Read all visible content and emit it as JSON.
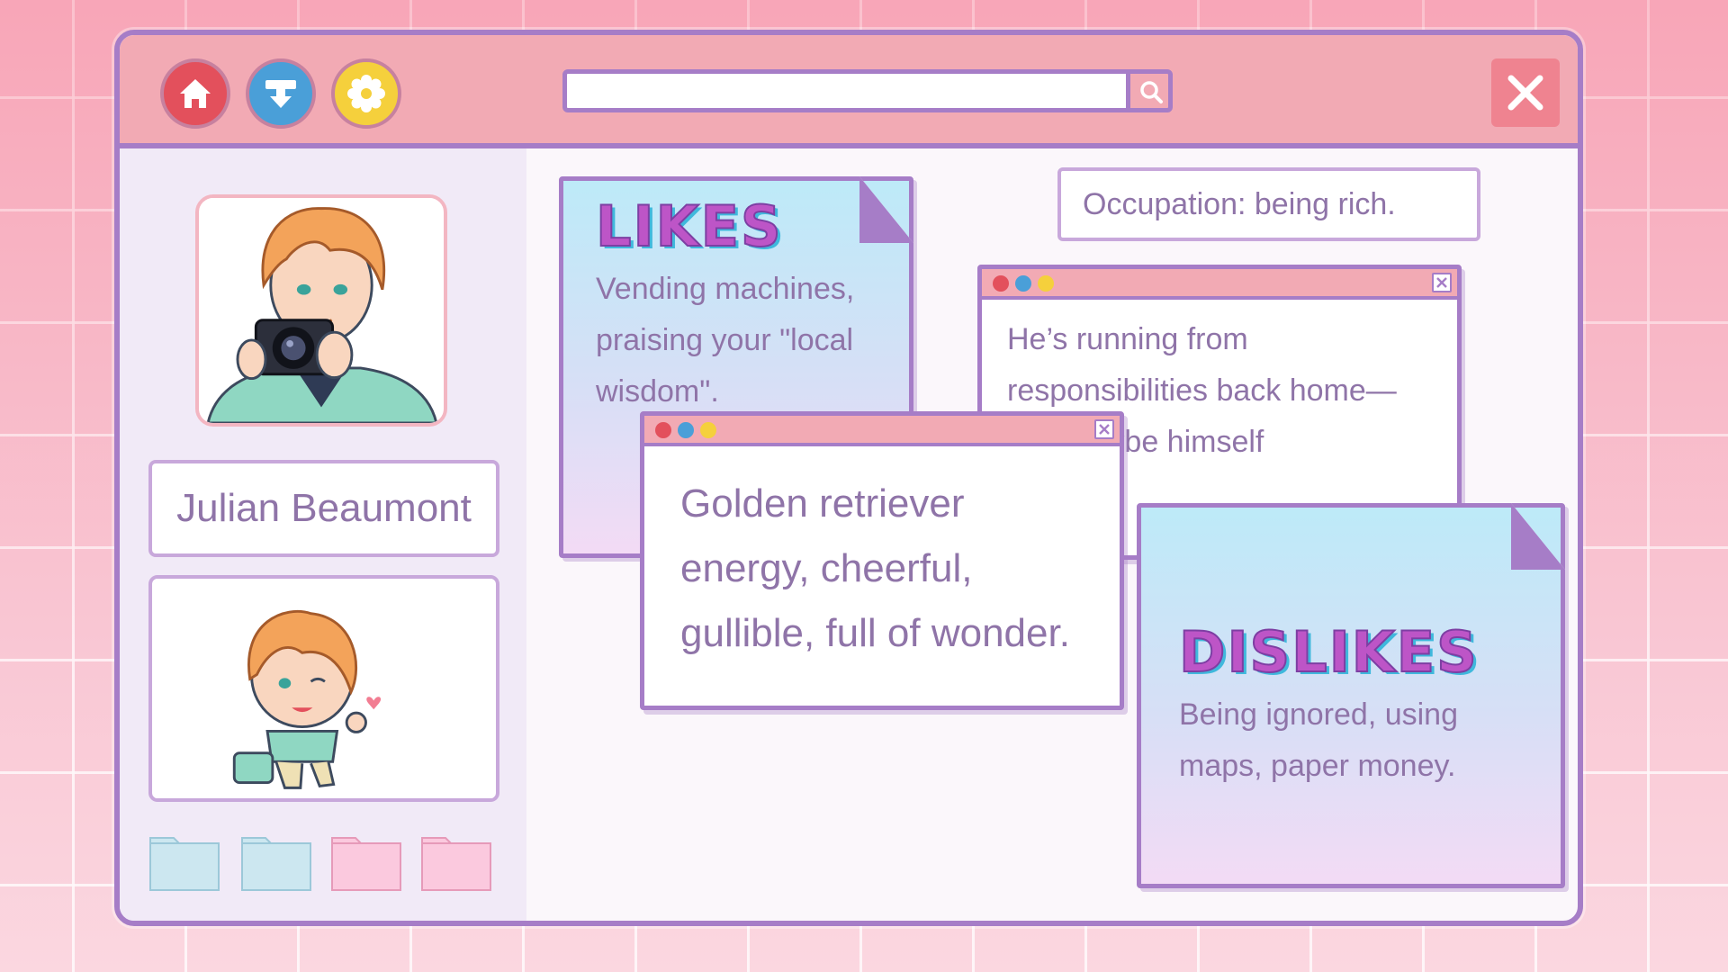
{
  "toolbar": {
    "home_icon": "home-icon",
    "download_icon": "download-icon",
    "settings_icon": "gear-icon",
    "search": {
      "value": "",
      "icon": "search-icon"
    },
    "close_icon": "close-icon"
  },
  "profile": {
    "name": "Julian Beaumont",
    "folders": [
      {
        "color": "#cce7f0"
      },
      {
        "color": "#cce7f0"
      },
      {
        "color": "#fbc9de"
      },
      {
        "color": "#fbc9de"
      }
    ]
  },
  "likes": {
    "title": "LIKES",
    "text": "Vending machines, praising your \"local wisdom\"."
  },
  "dislikes": {
    "title": "DISLIKES",
    "text": "Being ignored, using maps, paper money."
  },
  "occupation": "Occupation: being rich.",
  "backstory_popup": {
    "text": "He’s running from responsibilities back home—and maybe himself"
  },
  "personality_popup": {
    "text": "Golden retriever energy, cheerful, gullible, full of wonder."
  },
  "colors": {
    "window_border": "#a67dc7",
    "titlebar": "#f2aab4",
    "text": "#8f74a8",
    "dot_red": "#e3505c",
    "dot_blue": "#4a9fd8",
    "dot_yellow": "#f5d03c"
  }
}
